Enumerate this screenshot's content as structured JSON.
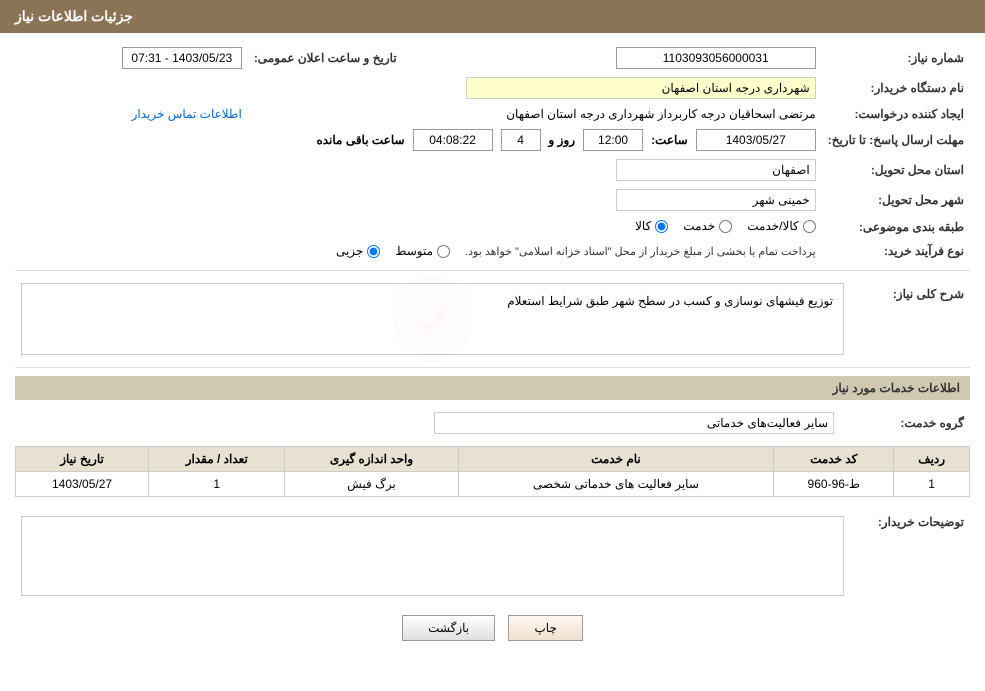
{
  "header": {
    "title": "جزئیات اطلاعات نیاز"
  },
  "form": {
    "need_number_label": "شماره نیاز:",
    "need_number_value": "1103093056000031",
    "buyer_org_label": "نام دستگاه خریدار:",
    "buyer_org_value": "شهرداری درجه استان اصفهان",
    "requester_label": "ایجاد کننده درخواست:",
    "requester_value": "مرتضی اسحاقیان درجه کاربرداز شهرداری درجه استان اصفهان",
    "contact_link": "اطلاعات تماس خریدار",
    "deadline_label": "مهلت ارسال پاسخ: تا تاریخ:",
    "deadline_date": "1403/05/27",
    "deadline_time_label": "ساعت:",
    "deadline_time": "12:00",
    "deadline_days_label": "روز و",
    "deadline_days": "4",
    "deadline_remaining_label": "ساعت باقی مانده",
    "deadline_remaining": "04:08:22",
    "announcement_label": "تاریخ و ساعت اعلان عمومی:",
    "announcement_value": "1403/05/23 - 07:31",
    "province_label": "استان محل تحویل:",
    "province_value": "اصفهان",
    "city_label": "شهر محل تحویل:",
    "city_value": "خمینی شهر",
    "category_label": "طبقه بندی موضوعی:",
    "category_kala": "کالا",
    "category_khedmat": "خدمت",
    "category_kala_khedmat": "کالا/خدمت",
    "process_label": "نوع فرآیند خرید:",
    "process_jozi": "جزیی",
    "process_motavaset": "متوسط",
    "process_note": "پرداخت تمام یا بخشی از مبلغ خریدار از محل \"اسناد خزانه اسلامی\" خواهد بود.",
    "description_section_label": "شرح کلی نیاز:",
    "description_value": "توزیع فیشهای نوسازی و کسب در سطح  شهر طبق شرایط استعلام",
    "services_section_title": "اطلاعات خدمات مورد نیاز",
    "service_group_label": "گروه خدمت:",
    "service_group_value": "سایر فعالیت‌های خدماتی",
    "table": {
      "headers": [
        "ردیف",
        "کد خدمت",
        "نام خدمت",
        "واحد اندازه گیری",
        "تعداد / مقدار",
        "تاریخ نیاز"
      ],
      "rows": [
        {
          "row": "1",
          "code": "ط-96-960",
          "name": "سایر فعالیت های خدماتی شخصی",
          "unit": "برگ فیش",
          "quantity": "1",
          "date": "1403/05/27"
        }
      ]
    },
    "buyer_notes_label": "توضیحات خریدار:",
    "back_button": "بازگشت",
    "print_button": "چاپ"
  }
}
